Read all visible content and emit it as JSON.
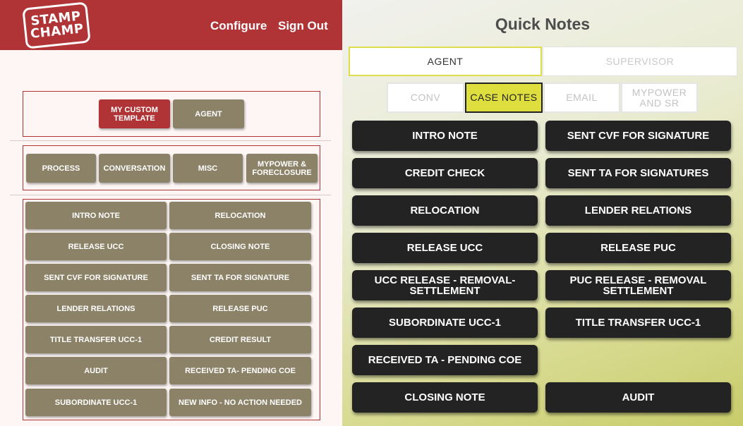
{
  "brand": {
    "logo_line1": "STAMP",
    "logo_line2": "CHAMP"
  },
  "header": {
    "configure": "Configure",
    "sign_out": "Sign Out"
  },
  "left": {
    "templates": [
      "MY CUSTOM TEMPLATE",
      "AGENT"
    ],
    "categories": [
      "PROCESS",
      "CONVERSATION",
      "MISC",
      "MYPOWER & FORECLOSURE"
    ],
    "notes": [
      "INTRO NOTE",
      "RELOCATION",
      "RELEASE UCC",
      "CLOSING NOTE",
      "SENT CVF FOR SIGNATURE",
      "SENT TA FOR SIGNATURE",
      "LENDER RELATIONS",
      "RELEASE PUC",
      "TITLE TRANSFER UCC-1",
      "CREDIT RESULT",
      "AUDIT",
      "RECEIVED TA- PENDING COE",
      "SUBORDINATE UCC-1",
      "NEW INFO - NO ACTION NEEDED"
    ]
  },
  "quick_notes": {
    "title": "Quick Notes",
    "role_tabs": [
      "AGENT",
      "SUPERVISOR"
    ],
    "sub_tabs": [
      "CONV",
      "CASE NOTES",
      "EMAIL",
      "MYPOWER AND SR"
    ],
    "buttons": [
      "INTRO NOTE",
      "SENT CVF FOR SIGNATURE",
      "CREDIT CHECK",
      "SENT TA FOR SIGNATURES",
      "RELOCATION",
      "LENDER RELATIONS",
      "RELEASE UCC",
      "RELEASE PUC",
      "UCC RELEASE - REMOVAL-SETTLEMENT",
      "PUC RELEASE - REMOVAL SETTLEMENT",
      "SUBORDINATE UCC-1",
      "TITLE TRANSFER UCC-1",
      "RECEIVED TA - PENDING COE",
      "CLOSING NOTE",
      "AUDIT"
    ]
  },
  "colors": {
    "header_red": "#b03436",
    "left_button": "#8b8268",
    "selected_tab": "#dede3e",
    "note_button": "#232323"
  }
}
